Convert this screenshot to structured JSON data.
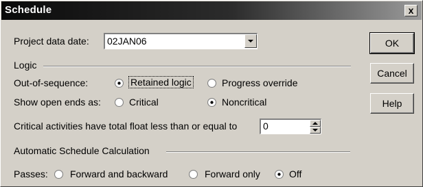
{
  "window": {
    "title": "Schedule",
    "close_glyph": "x"
  },
  "project_date": {
    "label": "Project data date:",
    "value": "02JAN06"
  },
  "logic": {
    "group_label": "Logic",
    "out_of_sequence": {
      "label": "Out-of-sequence:",
      "options": [
        {
          "label": "Retained logic",
          "selected": true
        },
        {
          "label": "Progress override",
          "selected": false
        }
      ]
    },
    "open_ends": {
      "label": "Show open ends as:",
      "options": [
        {
          "label": "Critical",
          "selected": false
        },
        {
          "label": "Noncritical",
          "selected": true
        }
      ]
    },
    "float_label": "Critical activities have total float less than or equal to",
    "float_value": "0"
  },
  "auto_calc": {
    "group_label": "Automatic Schedule Calculation",
    "passes_label": "Passes:",
    "options": [
      {
        "label": "Forward and backward",
        "selected": false
      },
      {
        "label": "Forward only",
        "selected": false
      },
      {
        "label": "Off",
        "selected": true
      }
    ]
  },
  "buttons": {
    "ok": "OK",
    "cancel": "Cancel",
    "help": "Help"
  }
}
